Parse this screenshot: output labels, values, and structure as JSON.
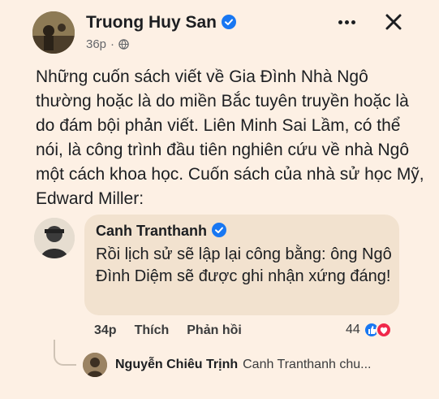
{
  "post": {
    "author": "Truong Huy San",
    "time": "36p",
    "separator": "·",
    "paragraphs": [
      "Những cuốn sách viết về Gia Đình Nhà Ngô thường hoặc là do miền Bắc tuyên truyền hoặc là do đám bội phản viết. Liên Minh Sai Lầm, có thể nói, là công trình đầu tiên nghiên cứu về nhà Ngô một cách khoa học. Cuốn sách của nhà sử học Mỹ,  Edward Miller:"
    ]
  },
  "comment": {
    "author": "Canh Tranthanh",
    "text": "Rồi lịch sử sẽ lập lại công bằng: ông Ngô Đình Diệm sẽ được ghi nhận xứng đáng!",
    "time": "34p",
    "like_label": "Thích",
    "reply_label": "Phản hồi",
    "reaction_count": "44"
  },
  "reply_preview": {
    "author": "Nguyễn Chiêu Trịnh",
    "snippet": "Canh Tranthanh chu..."
  },
  "icons": {
    "verified": "verified-badge-icon",
    "globe": "globe-icon",
    "more": "more-options-icon",
    "close": "close-icon",
    "like": "like-reaction-icon",
    "love": "love-reaction-icon"
  },
  "colors": {
    "accent": "#1877f2",
    "love": "#f0284a",
    "background": "#fdf0e4",
    "bubble": "#f2e2cf"
  }
}
